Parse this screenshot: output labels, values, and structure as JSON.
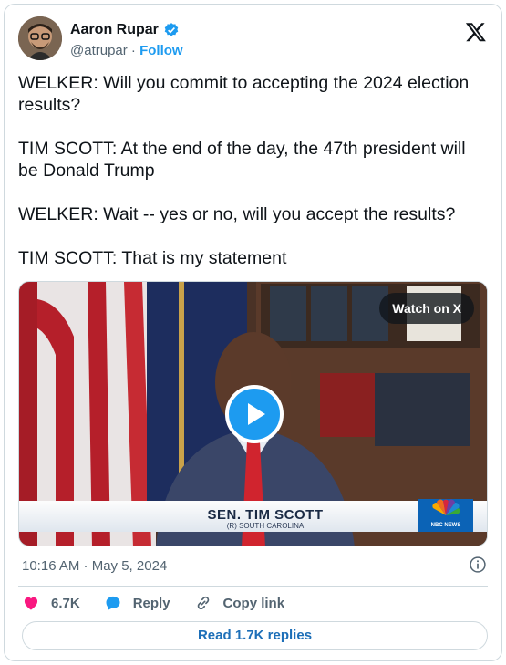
{
  "author": {
    "name": "Aaron Rupar",
    "handle": "@atrupar",
    "separator": " · ",
    "follow_label": "Follow"
  },
  "tweet": {
    "text": "WELKER: Will you commit to accepting the 2024 election results?\n\nTIM SCOTT: At the end of the day, the 47th president will be Donald Trump\n\nWELKER: Wait -- yes or no, will you accept the results?\n\nTIM SCOTT: That is my statement"
  },
  "media": {
    "watch_label": "Watch on X",
    "chyron_name": "SEN. TIM SCOTT",
    "chyron_sub": "(R) SOUTH CAROLINA",
    "network": "NBC NEWS"
  },
  "timestamp": "10:16 AM · May 5, 2024",
  "actions": {
    "likes": "6.7K",
    "reply_label": "Reply",
    "copy_label": "Copy link"
  },
  "read_replies_label": "Read 1.7K replies",
  "colors": {
    "accent": "#1d9bf0",
    "like": "#f91880",
    "muted": "#536471"
  }
}
